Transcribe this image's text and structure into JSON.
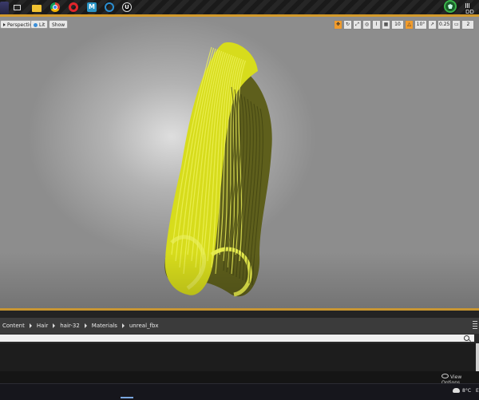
{
  "top_bar": {
    "right_label": "DD"
  },
  "viewport": {
    "buttons": {
      "perspective": "Perspective",
      "lit": "Lit",
      "show": "Show"
    },
    "toolbar": {
      "grid_snap": "10",
      "rotation_snap": "10°",
      "scale_snap": "0.25",
      "camera_speed": "2"
    },
    "hair_color": "#d7dc1c"
  },
  "content_browser": {
    "breadcrumb": [
      "Content",
      "Hair",
      "hair-32",
      "Materials",
      "unreal_fbx"
    ],
    "search_placeholder": "",
    "view_options_label": "View Options"
  },
  "taskbar": {
    "apps": [
      "windows-start",
      "task-view",
      "file-explorer",
      "chrome",
      "opera",
      "marvelous-designer",
      "ccleaner",
      "unreal-engine"
    ],
    "marvelous_letter": "M",
    "unreal_letter": "U",
    "temperature": "8°C",
    "temperature_extra": "E"
  },
  "colors": {
    "accent_orange": "#d39a2b",
    "toolbar_highlight": "#f09b2c"
  }
}
